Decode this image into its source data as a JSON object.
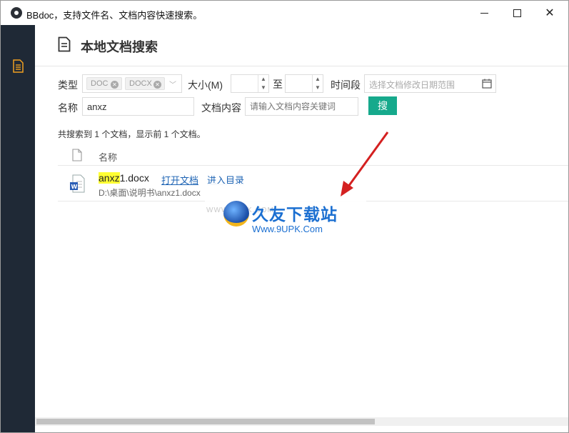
{
  "window": {
    "title": "BBdoc，支持文件名、文档内容快速搜索。"
  },
  "sidebar": {
    "items": [
      {
        "icon": "document-icon"
      }
    ]
  },
  "header": {
    "title": "本地文档搜索",
    "icon": "document-icon"
  },
  "filters": {
    "type_label": "类型",
    "type_tags": [
      "DOC",
      "DOCX"
    ],
    "size_label": "大小(M)",
    "size_to_label": "至",
    "size_min": "",
    "size_max": "",
    "date_label": "时间段",
    "date_placeholder": "选择文档修改日期范围",
    "name_label": "名称",
    "name_value": "anxz",
    "content_label": "文档内容",
    "content_placeholder": "请输入文档内容关键词",
    "search_button": "搜"
  },
  "results": {
    "summary": "共搜索到 1 个文档，显示前 1 个文档。",
    "column_name": "名称",
    "rows": [
      {
        "name_highlight": "anxz",
        "name_rest": "1.docx",
        "open_link": "打开文档",
        "dir_link": "进入目录",
        "path": "D:\\桌面\\说明书\\anxz1.docx"
      }
    ]
  },
  "watermark": {
    "small": "WWW.9UPK.COM",
    "brand": "久友下载站",
    "url": "Www.9UPK.Com"
  },
  "colors": {
    "sidebar": "#1f2936",
    "accent": "#16a98c",
    "link": "#1e64b4",
    "highlight": "#ffff33",
    "icon_orange": "#f0a020"
  }
}
